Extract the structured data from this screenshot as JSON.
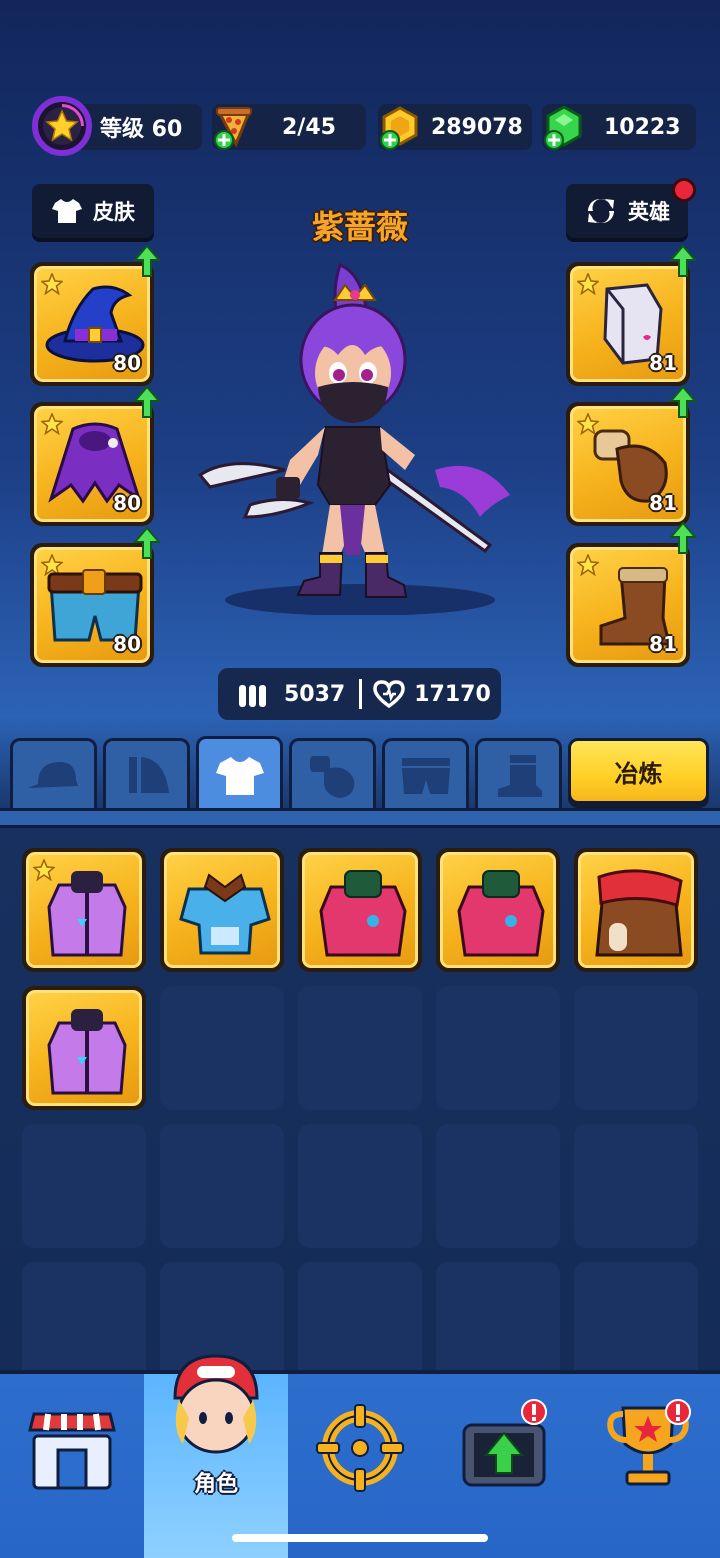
{
  "top_bar": {
    "level": "等级 60",
    "energy": "2/45",
    "gold": "289078",
    "gems": "10223"
  },
  "header": {
    "skin_button": "皮肤",
    "hero_name": "紫蔷薇",
    "hero_button": "英雄"
  },
  "equipment": {
    "left": [
      {
        "icon": "wizard-hat-icon",
        "level": "80"
      },
      {
        "icon": "purple-cloak-icon",
        "level": "80"
      },
      {
        "icon": "belt-shorts-icon",
        "level": "80"
      }
    ],
    "right": [
      {
        "icon": "armor-vest-icon",
        "level": "81"
      },
      {
        "icon": "leather-glove-icon",
        "level": "81"
      },
      {
        "icon": "leather-boot-icon",
        "level": "81"
      }
    ]
  },
  "stats": {
    "attack": "5037",
    "health": "17170"
  },
  "tabs": {
    "items": [
      {
        "icon": "cap-tab-icon"
      },
      {
        "icon": "cloak-tab-icon"
      },
      {
        "icon": "shirt-tab-icon"
      },
      {
        "icon": "glove-tab-icon"
      },
      {
        "icon": "shorts-tab-icon"
      },
      {
        "icon": "boot-tab-icon"
      }
    ],
    "active_index": 2,
    "smelt_button": "冶炼"
  },
  "inventory": [
    {
      "icon": "purple-hoodie-icon",
      "starred": true
    },
    {
      "icon": "blue-shirt-bow-icon",
      "starred": false
    },
    {
      "icon": "pink-jacket-icon",
      "starred": false
    },
    {
      "icon": "pink-jacket-icon",
      "starred": false
    },
    {
      "icon": "red-scarf-coat-icon",
      "starred": false
    },
    {
      "icon": "purple-hoodie-icon",
      "starred": false
    }
  ],
  "bottom_nav": {
    "active_label": "角色",
    "items": [
      "shop-icon",
      "character-icon",
      "target-icon",
      "upgrade-chest-icon",
      "trophy-icon"
    ]
  },
  "colors": {
    "gold_slot": "#f6b21c",
    "active_tab": "#4c8de0",
    "smelt_button": "#ffd026",
    "hero_name": "#f7a52a"
  }
}
